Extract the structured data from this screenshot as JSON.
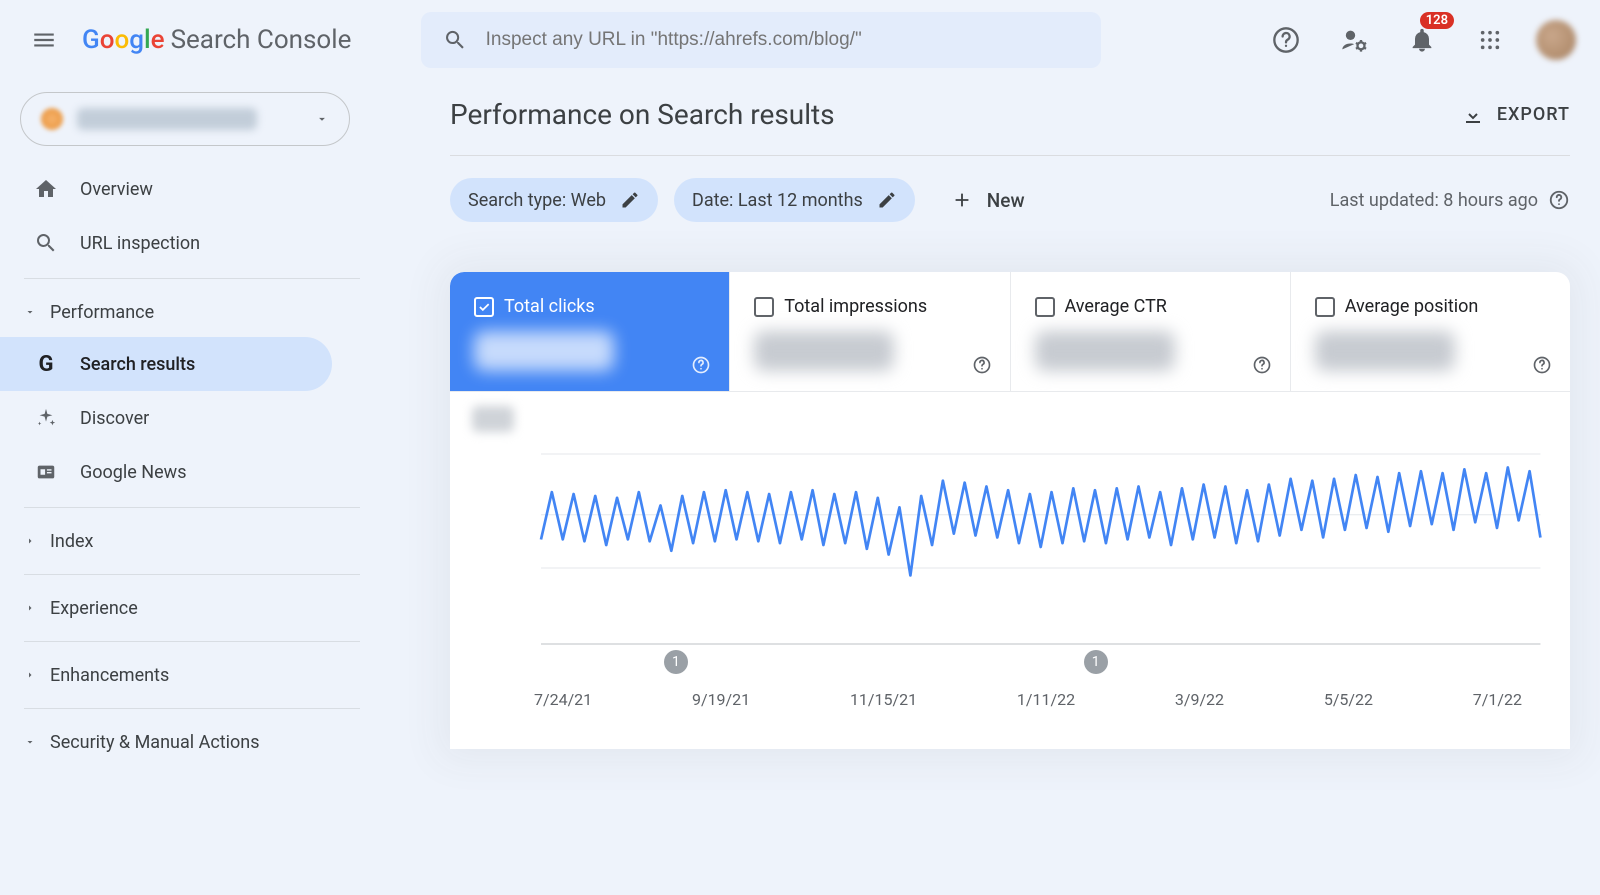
{
  "header": {
    "app_name_prefix": "Google",
    "app_name_suffix": "Search Console",
    "search_placeholder": "Inspect any URL in \"https://ahrefs.com/blog/\"",
    "badge_count": "128"
  },
  "sidebar": {
    "items_top": [
      {
        "icon": "home",
        "label": "Overview"
      },
      {
        "icon": "search",
        "label": "URL inspection"
      }
    ],
    "section_performance": "Performance",
    "items_perf": [
      {
        "icon": "g",
        "label": "Search results",
        "selected": true
      },
      {
        "icon": "spark",
        "label": "Discover"
      },
      {
        "icon": "news",
        "label": "Google News"
      }
    ],
    "section_index": "Index",
    "section_experience": "Experience",
    "section_enhancements": "Enhancements",
    "section_security": "Security & Manual Actions"
  },
  "page": {
    "title": "Performance on Search results",
    "export_label": "EXPORT",
    "chip_search_type": "Search type: Web",
    "chip_date": "Date: Last 12 months",
    "new_label": "New",
    "last_updated": "Last updated: 8 hours ago"
  },
  "metrics": [
    {
      "label": "Total clicks",
      "checked": true
    },
    {
      "label": "Total impressions",
      "checked": false
    },
    {
      "label": "Average CTR",
      "checked": false
    },
    {
      "label": "Average position",
      "checked": false
    }
  ],
  "chart_data": {
    "type": "line",
    "title": "",
    "xlabel": "",
    "ylabel": "",
    "y_gridlines": [
      0,
      0.4,
      0.68,
      1.0
    ],
    "x_ticks": [
      "7/24/21",
      "9/19/21",
      "11/15/21",
      "1/11/22",
      "3/9/22",
      "5/5/22",
      "7/1/22"
    ],
    "annotations": [
      {
        "type": "bubble",
        "x_frac": 0.135,
        "label": "1"
      },
      {
        "type": "bubble",
        "x_frac": 0.555,
        "label": "1"
      }
    ],
    "series": [
      {
        "name": "Total clicks",
        "color": "#4285f4",
        "note": "periodic weekly pattern; y values are relative (0..1) because actual axis labels are redacted in source",
        "values": [
          0.55,
          0.8,
          0.55,
          0.79,
          0.54,
          0.78,
          0.52,
          0.77,
          0.55,
          0.8,
          0.54,
          0.73,
          0.49,
          0.78,
          0.53,
          0.8,
          0.54,
          0.81,
          0.55,
          0.8,
          0.54,
          0.79,
          0.53,
          0.8,
          0.55,
          0.81,
          0.52,
          0.79,
          0.53,
          0.8,
          0.5,
          0.77,
          0.47,
          0.72,
          0.36,
          0.78,
          0.52,
          0.86,
          0.58,
          0.85,
          0.57,
          0.83,
          0.56,
          0.81,
          0.53,
          0.79,
          0.51,
          0.8,
          0.53,
          0.82,
          0.54,
          0.81,
          0.53,
          0.82,
          0.55,
          0.83,
          0.56,
          0.8,
          0.52,
          0.82,
          0.55,
          0.84,
          0.56,
          0.83,
          0.53,
          0.81,
          0.54,
          0.84,
          0.57,
          0.87,
          0.6,
          0.86,
          0.56,
          0.87,
          0.6,
          0.89,
          0.61,
          0.88,
          0.59,
          0.9,
          0.62,
          0.91,
          0.63,
          0.9,
          0.6,
          0.92,
          0.64,
          0.9,
          0.61,
          0.93,
          0.65,
          0.91,
          0.56
        ]
      }
    ]
  }
}
